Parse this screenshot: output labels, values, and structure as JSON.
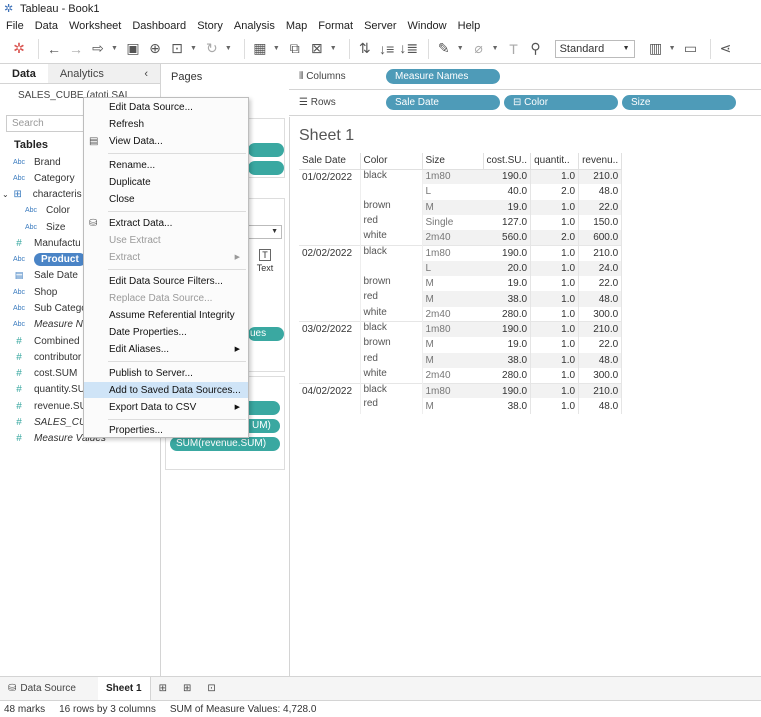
{
  "window": {
    "title": "Tableau - Book1"
  },
  "menu": [
    "File",
    "Data",
    "Worksheet",
    "Dashboard",
    "Story",
    "Analysis",
    "Map",
    "Format",
    "Server",
    "Window",
    "Help"
  ],
  "toolbar": {
    "view_size": "Standard"
  },
  "left_pane": {
    "tab_data": "Data",
    "tab_analytics": "Analytics",
    "datasource": "SALES_CUBE (atoti SAL",
    "search_placeholder": "Search",
    "tables_title": "Tables",
    "fields": [
      {
        "type": "Abc",
        "label": "Brand"
      },
      {
        "type": "Abc",
        "label": "Category"
      },
      {
        "type": "hier",
        "label": "characteris"
      },
      {
        "type": "Abc",
        "label": "Color"
      },
      {
        "type": "Abc",
        "label": "Size"
      },
      {
        "type": "#",
        "label": "Manufactu"
      },
      {
        "type": "Abc",
        "label": "Product"
      },
      {
        "type": "date",
        "label": "Sale Date"
      },
      {
        "type": "Abc",
        "label": "Shop"
      },
      {
        "type": "Abc",
        "label": "Sub Catego"
      },
      {
        "type": "Abc",
        "label": "Measure N"
      },
      {
        "type": "#",
        "label": "Combined"
      },
      {
        "type": "#",
        "label": "contributor"
      },
      {
        "type": "#",
        "label": "cost.SUM"
      },
      {
        "type": "#",
        "label": "quantity.SU"
      },
      {
        "type": "#",
        "label": "revenue.SU"
      },
      {
        "type": "#",
        "label": "SALES_CU"
      },
      {
        "type": "#",
        "label": "Measure Values"
      }
    ]
  },
  "mid_pane": {
    "pages_title": "Pages",
    "marks_text_label": "Text",
    "measure_values_pill": "ues",
    "mv_pill_1": "",
    "mv_pill_2": "UM)",
    "mv_pill_3": "SUM(revenue.SUM)"
  },
  "shelves": {
    "columns_label": "Columns",
    "rows_label": "Rows",
    "columns_pills": [
      "Measure Names"
    ],
    "rows_pills": [
      "Sale Date",
      "Color",
      "Size"
    ]
  },
  "sheet": {
    "title": "Sheet 1",
    "headers": [
      "Sale Date",
      "Color",
      "Size",
      "cost.SU..",
      "quantit..",
      "revenu.."
    ],
    "rows": [
      {
        "date": "01/02/2022",
        "color": "black",
        "size": "1m80",
        "cost": "190.0",
        "qty": "1.0",
        "rev": "210.0"
      },
      {
        "date": "",
        "color": "",
        "size": "L",
        "cost": "40.0",
        "qty": "2.0",
        "rev": "48.0"
      },
      {
        "date": "",
        "color": "brown",
        "size": "M",
        "cost": "19.0",
        "qty": "1.0",
        "rev": "22.0"
      },
      {
        "date": "",
        "color": "red",
        "size": "Single",
        "cost": "127.0",
        "qty": "1.0",
        "rev": "150.0"
      },
      {
        "date": "",
        "color": "white",
        "size": "2m40",
        "cost": "560.0",
        "qty": "2.0",
        "rev": "600.0"
      },
      {
        "date": "02/02/2022",
        "color": "black",
        "size": "1m80",
        "cost": "190.0",
        "qty": "1.0",
        "rev": "210.0"
      },
      {
        "date": "",
        "color": "",
        "size": "L",
        "cost": "20.0",
        "qty": "1.0",
        "rev": "24.0"
      },
      {
        "date": "",
        "color": "brown",
        "size": "M",
        "cost": "19.0",
        "qty": "1.0",
        "rev": "22.0"
      },
      {
        "date": "",
        "color": "red",
        "size": "M",
        "cost": "38.0",
        "qty": "1.0",
        "rev": "48.0"
      },
      {
        "date": "",
        "color": "white",
        "size": "2m40",
        "cost": "280.0",
        "qty": "1.0",
        "rev": "300.0"
      },
      {
        "date": "03/02/2022",
        "color": "black",
        "size": "1m80",
        "cost": "190.0",
        "qty": "1.0",
        "rev": "210.0"
      },
      {
        "date": "",
        "color": "brown",
        "size": "M",
        "cost": "19.0",
        "qty": "1.0",
        "rev": "22.0"
      },
      {
        "date": "",
        "color": "red",
        "size": "M",
        "cost": "38.0",
        "qty": "1.0",
        "rev": "48.0"
      },
      {
        "date": "",
        "color": "white",
        "size": "2m40",
        "cost": "280.0",
        "qty": "1.0",
        "rev": "300.0"
      },
      {
        "date": "04/02/2022",
        "color": "black",
        "size": "1m80",
        "cost": "190.0",
        "qty": "1.0",
        "rev": "210.0"
      },
      {
        "date": "",
        "color": "red",
        "size": "M",
        "cost": "38.0",
        "qty": "1.0",
        "rev": "48.0"
      }
    ]
  },
  "context_menu": {
    "items": [
      {
        "label": "Edit Data Source...",
        "disabled": false,
        "submenu": false
      },
      {
        "label": "Refresh",
        "disabled": false,
        "submenu": false
      },
      {
        "label": "View Data...",
        "disabled": false,
        "submenu": false
      },
      {
        "label": "Rename...",
        "disabled": false,
        "submenu": false
      },
      {
        "label": "Duplicate",
        "disabled": false,
        "submenu": false
      },
      {
        "label": "Close",
        "disabled": false,
        "submenu": false
      },
      {
        "label": "Extract Data...",
        "disabled": false,
        "submenu": false
      },
      {
        "label": "Use Extract",
        "disabled": true,
        "submenu": false
      },
      {
        "label": "Extract",
        "disabled": true,
        "submenu": true
      },
      {
        "label": "Edit Data Source Filters...",
        "disabled": false,
        "submenu": false
      },
      {
        "label": "Replace Data Source...",
        "disabled": true,
        "submenu": false
      },
      {
        "label": "Assume Referential Integrity",
        "disabled": false,
        "submenu": false
      },
      {
        "label": "Date Properties...",
        "disabled": false,
        "submenu": false
      },
      {
        "label": "Edit Aliases...",
        "disabled": false,
        "submenu": true
      },
      {
        "label": "Publish to Server...",
        "disabled": false,
        "submenu": false
      },
      {
        "label": "Add to Saved Data Sources...",
        "disabled": false,
        "submenu": false,
        "highlighted": true
      },
      {
        "label": "Export Data to CSV",
        "disabled": false,
        "submenu": true
      },
      {
        "label": "Properties...",
        "disabled": false,
        "submenu": false
      }
    ]
  },
  "sheet_tabs": {
    "data_source": "Data Source",
    "active_sheet": "Sheet 1"
  },
  "status": {
    "marks": "48 marks",
    "rows_cols": "16 rows by 3 columns",
    "sum": "SUM of Measure Values: 4,728.0"
  }
}
